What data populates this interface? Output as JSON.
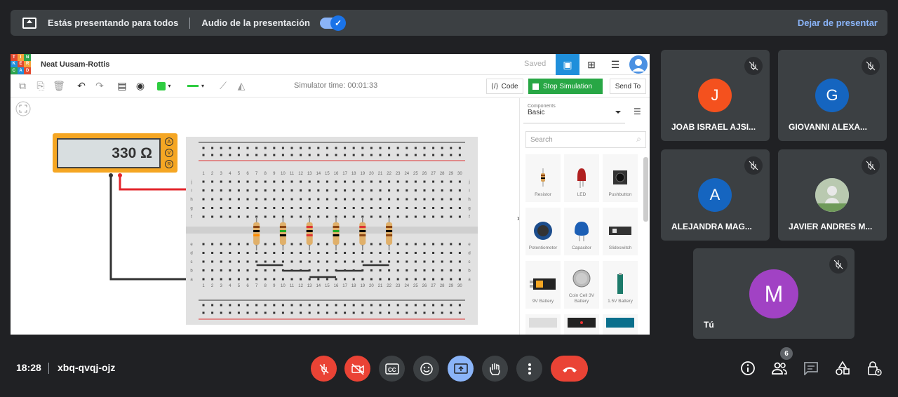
{
  "banner": {
    "presenting_text": "Estás presentando para todos",
    "audio_text": "Audio de la presentación",
    "audio_enabled": true,
    "stop_label": "Dejar de presentar"
  },
  "tinkercad": {
    "logo_letters": [
      "T",
      "I",
      "N",
      "K",
      "E",
      "R",
      "C",
      "A",
      "D"
    ],
    "project_name": "Neat Uusam-Rottis",
    "saved_label": "Saved",
    "simulator_time": "Simulator time: 00:01:33",
    "code_label": "Code",
    "stop_simulation_label": "Stop Simulation",
    "send_to_label": "Send To",
    "multimeter_reading": "330 Ω",
    "multimeter_modes": [
      "A",
      "V",
      "R"
    ],
    "components_label": "Components",
    "components_value": "Basic",
    "search_placeholder": "Search",
    "parts": [
      "Resistor",
      "LED",
      "Pushbutton",
      "Potentiometer",
      "Capacitor",
      "Slideswitch",
      "9V Battery",
      "Coin Cell 3V Battery",
      "1.5V Battery"
    ],
    "breadboard_columns": [
      "1",
      "2",
      "3",
      "4",
      "5",
      "6",
      "7",
      "8",
      "9",
      "10",
      "11",
      "12",
      "13",
      "14",
      "15",
      "16",
      "17",
      "18",
      "19",
      "20",
      "21",
      "22",
      "23",
      "24",
      "25",
      "26",
      "27",
      "28",
      "29",
      "30"
    ],
    "breadboard_rows_top": [
      "j",
      "i",
      "h",
      "g",
      "f"
    ],
    "breadboard_rows_bottom": [
      "e",
      "d",
      "c",
      "b",
      "a"
    ]
  },
  "participants": [
    {
      "name": "JOAB ISRAEL AJSI...",
      "initial": "J",
      "color": "#f4511e"
    },
    {
      "name": "GIOVANNI ALEXA...",
      "initial": "G",
      "color": "#1565c0"
    },
    {
      "name": "ALEJANDRA MAG...",
      "initial": "A",
      "color": "#1565c0"
    },
    {
      "name": "JAVIER ANDRES M...",
      "initial": "",
      "color": "#9fb8c8"
    },
    {
      "name": "Tú",
      "initial": "M",
      "color": "#a142c4"
    }
  ],
  "bottom": {
    "time": "18:28",
    "meeting_code": "xbq-qvqj-ojz",
    "people_count": "6"
  }
}
